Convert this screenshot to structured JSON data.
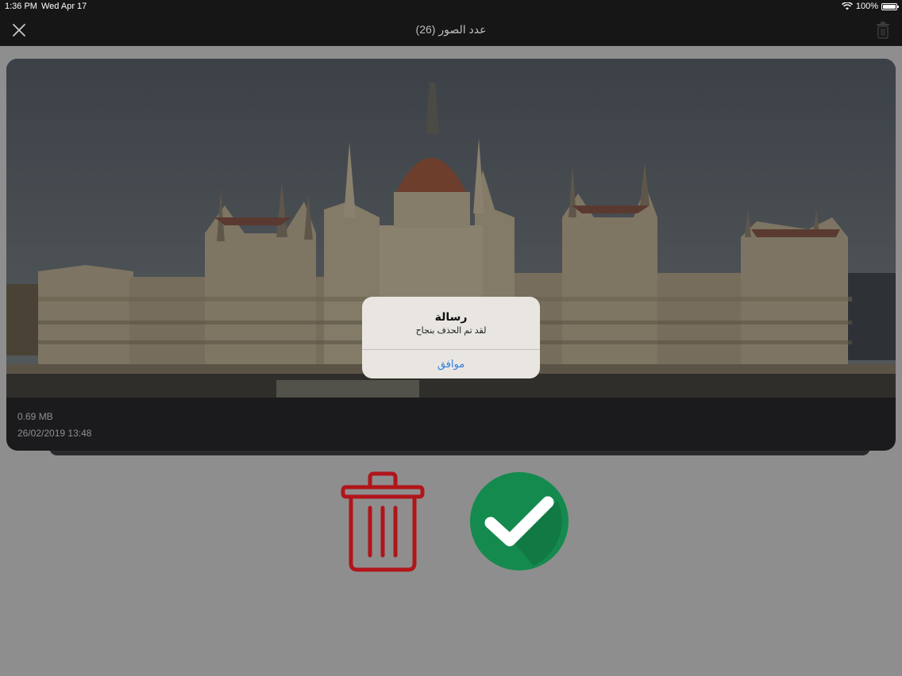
{
  "status_bar": {
    "time": "1:36 PM",
    "date": "Wed Apr 17",
    "battery_text": "100%",
    "battery_level": 1.0,
    "icons": [
      "wifi-icon",
      "battery-icon"
    ]
  },
  "nav": {
    "title": "عدد الصور (26)",
    "close_icon": "close-icon",
    "trash_icon": "trash-icon"
  },
  "photo": {
    "size": "0.69 MB",
    "datetime": "26/02/2019 13:48"
  },
  "alert": {
    "title": "رسالة",
    "message": "لقد تم الحذف بنجاح",
    "ok_label": "موافق"
  },
  "actions": {
    "delete_icon": "trash-icon",
    "keep_icon": "checkmark-icon",
    "delete_color": "#b0151a",
    "keep_color": "#158a4e"
  },
  "colors": {
    "background": "#8e8e8e",
    "bar": "#161616",
    "card": "#1b1b1d",
    "alert_bg": "#e9e6e1",
    "alert_button": "#2f7fe0"
  }
}
